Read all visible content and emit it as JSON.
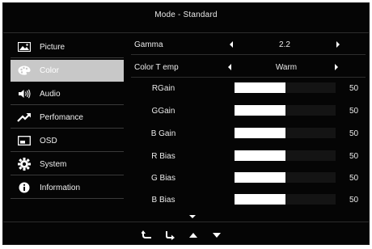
{
  "header": {
    "title": "Mode - Standard"
  },
  "sidebar": {
    "items": [
      {
        "label": "Picture",
        "icon": "picture-icon",
        "active": false
      },
      {
        "label": "Color",
        "icon": "palette-icon",
        "active": true
      },
      {
        "label": "Audio",
        "icon": "speaker-icon",
        "active": false
      },
      {
        "label": "Perfomance",
        "icon": "trend-arrow-icon",
        "active": false
      },
      {
        "label": "OSD",
        "icon": "osd-window-icon",
        "active": false
      },
      {
        "label": "System",
        "icon": "gear-icon",
        "active": false
      },
      {
        "label": "Information",
        "icon": "info-icon",
        "active": false
      }
    ]
  },
  "settings": {
    "gamma": {
      "label": "Gamma",
      "value": "2.2"
    },
    "color_temp": {
      "label": "Color T emp",
      "value": "Warm"
    }
  },
  "sliders": [
    {
      "label": "RGain",
      "value": "50",
      "level": 0.5
    },
    {
      "label": "GGain",
      "value": "50",
      "level": 0.5
    },
    {
      "label": "B Gain",
      "value": "50",
      "level": 0.5
    },
    {
      "label": "R Bias",
      "value": "50",
      "level": 0.5
    },
    {
      "label": "G Bias",
      "value": "50",
      "level": 0.5
    },
    {
      "label": "B Bias",
      "value": "50",
      "level": 0.5
    }
  ],
  "nav_buttons": [
    "back-icon",
    "enter-icon",
    "up-icon",
    "down-icon"
  ],
  "colors": {
    "background": "#050505",
    "active_item": "#c8c8c8",
    "slider_fill": "#ffffff",
    "slider_track": "#141414"
  }
}
